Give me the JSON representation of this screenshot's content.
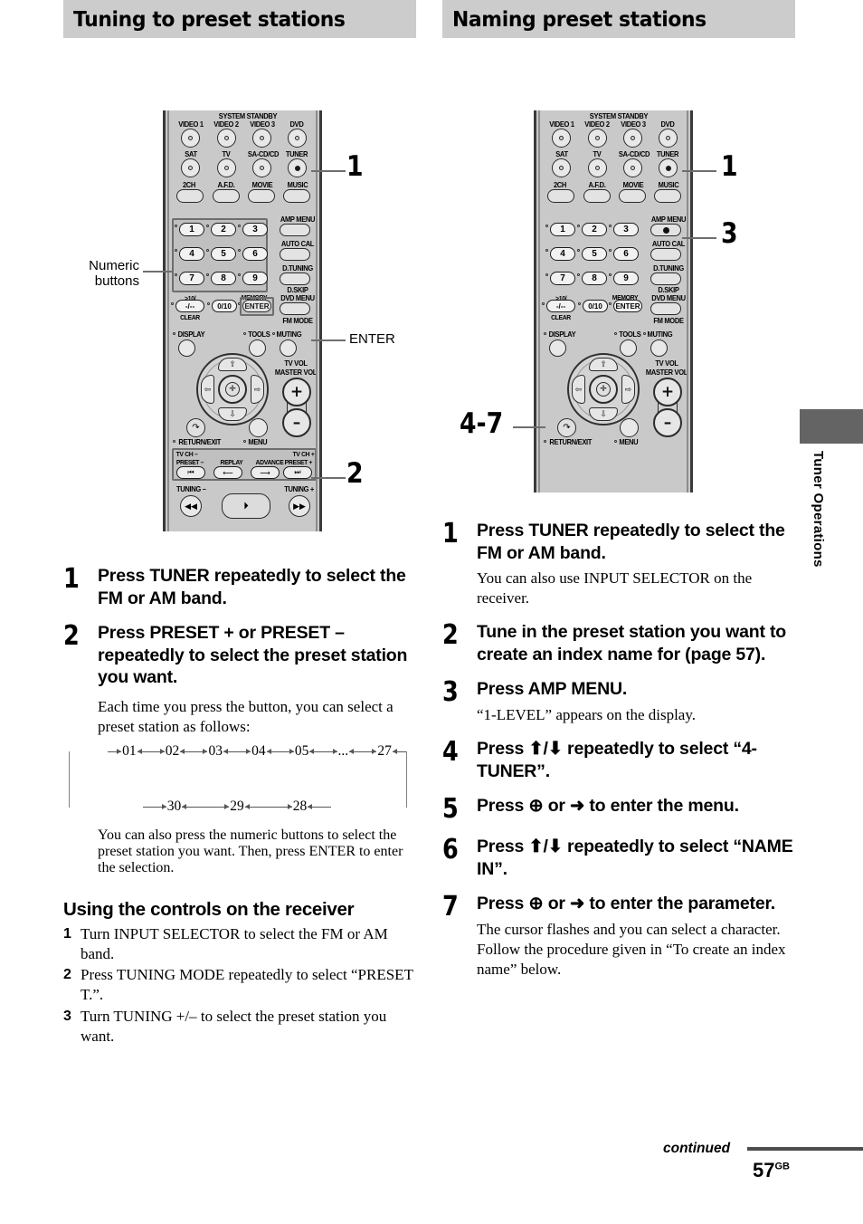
{
  "page": {
    "number": "57",
    "number_suffix": "GB",
    "continued_label": "continued",
    "side_tab": "Tuner Operations"
  },
  "left_section": {
    "title": "Tuning to preset stations",
    "callouts": {
      "numeric_buttons": "Numeric\nbuttons",
      "numeric_buttons_line1": "Numeric",
      "numeric_buttons_line2": "buttons",
      "enter": "ENTER",
      "one": "1",
      "two": "2"
    },
    "steps": [
      {
        "num": "1",
        "head": "Press TUNER repeatedly to select the FM or AM band.",
        "sub": ""
      },
      {
        "num": "2",
        "head": "Press PRESET + or PRESET – repeatedly to select the preset station you want.",
        "sub": "Each time you press the button, you can select a preset station as follows:"
      }
    ],
    "cycle_diagram": {
      "top_row": [
        "01",
        "02",
        "03",
        "04",
        "05",
        "...",
        "27"
      ],
      "bottom_row": [
        "30",
        "29",
        "28"
      ]
    },
    "after_diagram": "You can also press the numeric buttons to select the preset station you want. Then, press ENTER to enter the selection.",
    "subhead": "Using the controls on the receiver",
    "receiver_steps": [
      {
        "num": "1",
        "text": "Turn INPUT SELECTOR to select the FM or AM band."
      },
      {
        "num": "2",
        "text": "Press TUNING MODE repeatedly to select “PRESET T.”."
      },
      {
        "num": "3",
        "text": "Turn TUNING +/– to select the preset station you want."
      }
    ]
  },
  "right_section": {
    "title": "Naming preset stations",
    "callouts": {
      "one": "1",
      "three": "3",
      "four_seven": "4-7"
    },
    "steps": [
      {
        "num": "1",
        "head": "Press TUNER repeatedly to select the FM or AM band.",
        "sub": "You can also use INPUT SELECTOR on the receiver."
      },
      {
        "num": "2",
        "head": "Tune in the preset station you want to create an index name for (page 57).",
        "sub": ""
      },
      {
        "num": "3",
        "head": "Press AMP MENU.",
        "sub": "“1-LEVEL” appears on the display."
      },
      {
        "num": "4",
        "head": "Press ⬆/⬇ repeatedly to select “4-TUNER”.",
        "sub": ""
      },
      {
        "num": "5",
        "head": "Press ⊕ or ➜ to enter the menu.",
        "sub": ""
      },
      {
        "num": "6",
        "head": "Press ⬆/⬇ repeatedly to select “NAME IN”.",
        "sub": ""
      },
      {
        "num": "7",
        "head": "Press ⊕ or ➜ to enter the parameter.",
        "sub": "The cursor flashes and you can select a character. Follow the procedure given in “To create an index name” below."
      }
    ]
  },
  "remote": {
    "system_standby": "SYSTEM STANDBY",
    "input_row1": [
      "VIDEO 1",
      "VIDEO 2",
      "VIDEO 3",
      "DVD"
    ],
    "input_row2": [
      "SAT",
      "TV",
      "SA-CD/CD",
      "TUNER"
    ],
    "mode_row": [
      "2CH",
      "A.F.D.",
      "MOVIE",
      "MUSIC"
    ],
    "numeric": [
      "1",
      "2",
      "3",
      "4",
      "5",
      "6",
      "7",
      "8",
      "9"
    ],
    "num_bottom": {
      "gt10": ">10/.",
      "dash": "-/--",
      "clear": "CLEAR",
      "zero": "0/10",
      "memory": "MEMORY",
      "enter": "ENTER"
    },
    "side_col": [
      "AMP MENU",
      "AUTO CAL",
      "D.TUNING",
      "D.SKIP",
      "DVD MENU",
      "FM MODE"
    ],
    "display": "DISPLAY",
    "tools": "TOOLS",
    "muting": "MUTING",
    "tv_vol": "TV VOL",
    "master_vol": "MASTER VOL",
    "plus": "+",
    "minus": "–",
    "return_exit": "RETURN/EXIT",
    "menu": "MENU",
    "transport": {
      "tv_ch_minus": "TV CH –",
      "preset_minus": "PRESET –",
      "replay": "REPLAY",
      "advance": "ADVANCE",
      "tv_ch_plus": "TV CH +",
      "preset_plus": "PRESET +",
      "tuning_minus": "TUNING –",
      "tuning_plus": "TUNING +"
    }
  },
  "colors": {
    "header_bar": "#cccccc",
    "remote_body": "#c9c9c9",
    "side_tab": "#646464",
    "callout_line": "#6e6e6e"
  }
}
